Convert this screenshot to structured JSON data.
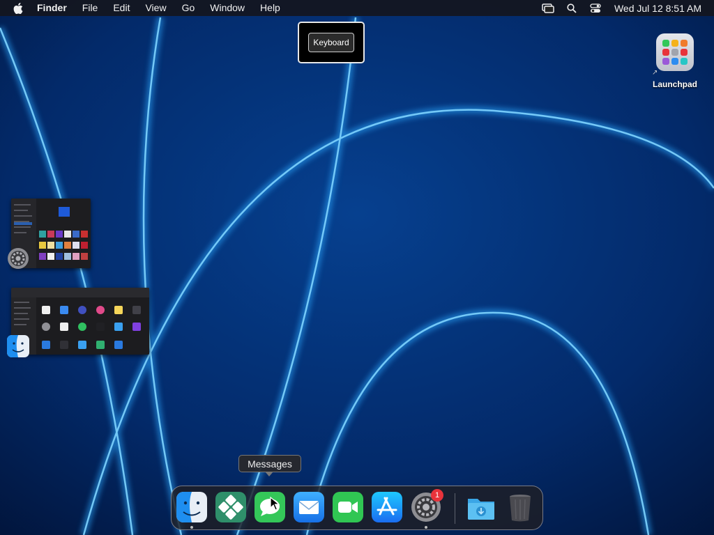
{
  "menubar": {
    "app_name": "Finder",
    "items": [
      "File",
      "Edit",
      "View",
      "Go",
      "Window",
      "Help"
    ],
    "clock": "Wed Jul 12  8:51 AM",
    "icons": [
      "screen-mirroring-icon",
      "spotlight-search-icon",
      "control-center-icon"
    ]
  },
  "hud": {
    "label": "Keyboard"
  },
  "desktop": {
    "launchpad_label": "Launchpad"
  },
  "stage": [
    {
      "app": "System Settings",
      "icon": "system-settings-icon"
    },
    {
      "app": "Finder",
      "icon": "finder-icon"
    }
  ],
  "tooltip": {
    "text": "Messages"
  },
  "dock": {
    "items": [
      {
        "name": "Finder",
        "icon": "finder-icon",
        "running": true
      },
      {
        "name": "Remote Desktop",
        "icon": "remote-desktop-icon",
        "running": false
      },
      {
        "name": "Messages",
        "icon": "messages-icon",
        "running": false
      },
      {
        "name": "Mail",
        "icon": "mail-icon",
        "running": false
      },
      {
        "name": "FaceTime",
        "icon": "facetime-icon",
        "running": false
      },
      {
        "name": "App Store",
        "icon": "app-store-icon",
        "running": false
      },
      {
        "name": "System Settings",
        "icon": "system-settings-icon",
        "running": true,
        "badge": "1"
      },
      {
        "name": "Downloads",
        "icon": "downloads-folder-icon",
        "running": false
      },
      {
        "name": "Trash",
        "icon": "trash-icon",
        "running": false
      }
    ]
  },
  "colors": {
    "wallpaper": "#021a4a",
    "glow": "#2aa8ff",
    "badge": "#e8333b"
  }
}
